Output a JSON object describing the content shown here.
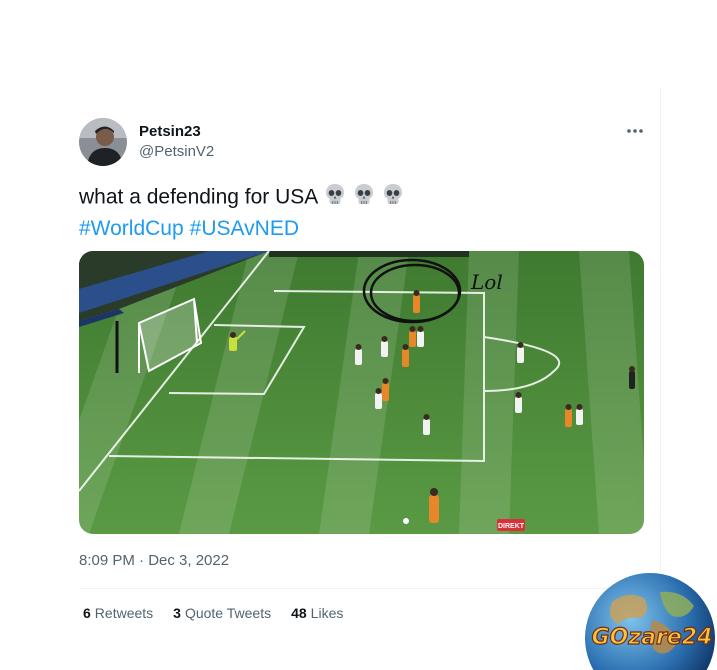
{
  "author": {
    "display_name": "Petsin23",
    "handle": "@PetsinV2"
  },
  "tweet": {
    "text": "what a defending for USA",
    "emoji": [
      "skull",
      "skull",
      "skull"
    ],
    "hashtags": [
      "#WorldCup",
      "#USAvNED"
    ]
  },
  "media": {
    "annotation_text": "Lol",
    "broadcast_badge": "DIREKT"
  },
  "timestamp": "8:09 PM · Dec 3, 2022",
  "stats": [
    {
      "count": "6",
      "label": "Retweets"
    },
    {
      "count": "3",
      "label": "Quote Tweets"
    },
    {
      "count": "48",
      "label": "Likes"
    }
  ],
  "watermark": {
    "text": "GOzare24"
  },
  "icons": {
    "more": "more-horizontal-icon",
    "emoji": "skull-emoji-icon"
  },
  "colors": {
    "link": "#1d9bf0",
    "secondary_text": "#536471",
    "primary_text": "#0f1419",
    "pitch": "#4d8a3a"
  }
}
